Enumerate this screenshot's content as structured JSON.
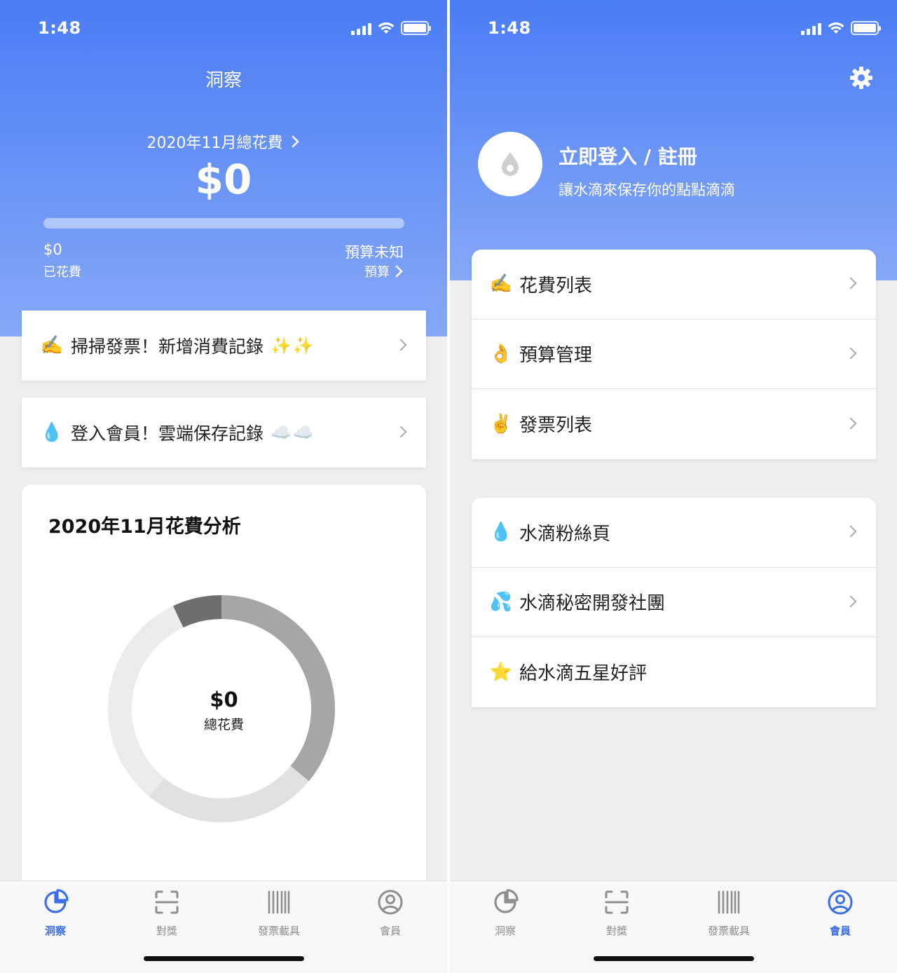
{
  "left_screen": {
    "status": {
      "time": "1:48"
    },
    "nav_title": "洞察",
    "summary": {
      "period_label": "2020年11月總花費",
      "total": "$0",
      "progress": 0,
      "spent_value": "$0",
      "spent_label": "已花費",
      "budget_value": "預算未知",
      "budget_label": "預算"
    },
    "actions": [
      {
        "emoji": "✍️",
        "text": "掃掃發票！新增消費記錄",
        "trail": "✨✨"
      },
      {
        "emoji": "💧",
        "text": "登入會員！雲端保存記錄",
        "trail": "☁️☁️"
      }
    ],
    "analysis": {
      "title": "2020年11月花費分析",
      "amount": "$0",
      "label": "總花費"
    },
    "chart_data": {
      "type": "pie",
      "title": "2020年11月花費分析",
      "variant": "donut",
      "values": [
        36,
        25,
        32,
        7
      ],
      "colors": [
        "#a6a6a6",
        "#e1e1e1",
        "#ececec",
        "#6e6e6e"
      ]
    }
  },
  "right_screen": {
    "status": {
      "time": "1:48"
    },
    "profile": {
      "title": "立即登入 / 註冊",
      "subtitle": "讓水滴來保存你的點點滴滴"
    },
    "menu_primary": [
      {
        "emoji": "✍️",
        "label": "花費列表",
        "chevron": true
      },
      {
        "emoji": "👌",
        "label": "預算管理",
        "chevron": true
      },
      {
        "emoji": "✌️",
        "label": "發票列表",
        "chevron": true
      }
    ],
    "menu_secondary": [
      {
        "emoji": "💧",
        "label": "水滴粉絲頁",
        "chevron": true
      },
      {
        "emoji": "💦",
        "label": "水滴秘密開發社團",
        "chevron": true
      },
      {
        "emoji": "⭐",
        "label": "給水滴五星好評",
        "chevron": false
      }
    ]
  },
  "tabs": [
    "洞察",
    "對獎",
    "發票載具",
    "會員"
  ],
  "colors": {
    "accent": "#3b6fe8",
    "hero": "#4a7cf5",
    "inactive": "#8e8e8e"
  }
}
